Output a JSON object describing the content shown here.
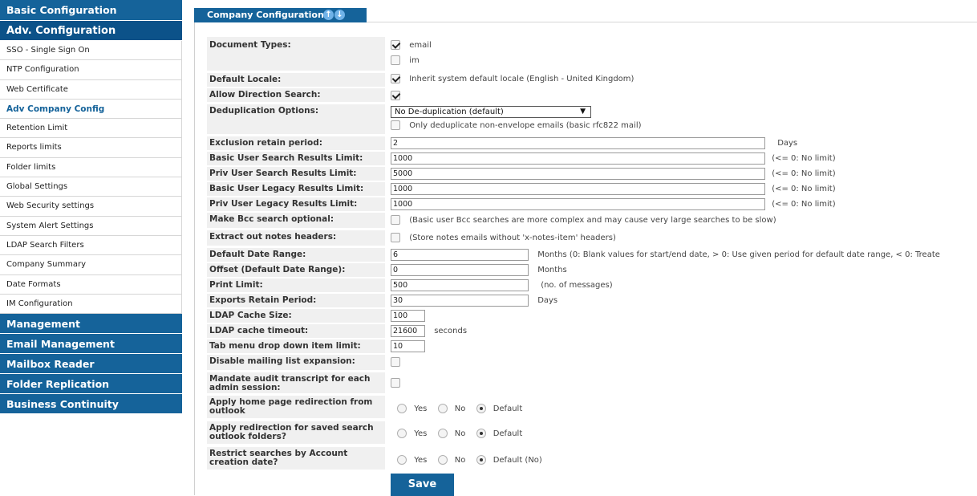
{
  "sidebar": {
    "sections_top": [
      {
        "label": "Basic Configuration"
      },
      {
        "label": "Adv. Configuration"
      }
    ],
    "items": [
      {
        "label": "SSO - Single Sign On"
      },
      {
        "label": "NTP Configuration"
      },
      {
        "label": "Web Certificate"
      },
      {
        "label": "Adv Company Config"
      },
      {
        "label": "Retention Limit"
      },
      {
        "label": "Reports limits"
      },
      {
        "label": "Folder limits"
      },
      {
        "label": "Global Settings"
      },
      {
        "label": "Web Security settings"
      },
      {
        "label": "System Alert Settings"
      },
      {
        "label": "LDAP Search Filters"
      },
      {
        "label": "Company Summary"
      },
      {
        "label": "Date Formats"
      },
      {
        "label": "IM Configuration"
      }
    ],
    "sections_bottom": [
      {
        "label": "Management"
      },
      {
        "label": "Email Management"
      },
      {
        "label": "Mailbox Reader"
      },
      {
        "label": "Folder Replication"
      },
      {
        "label": "Business Continuity"
      }
    ]
  },
  "tab": {
    "label": "Company Configuration"
  },
  "form": {
    "document_types": {
      "label": "Document Types:",
      "email": "email",
      "im": "im"
    },
    "default_locale": {
      "label": "Default Locale:",
      "text": "Inherit system default locale (English - United Kingdom)"
    },
    "allow_direction_search": {
      "label": "Allow Direction Search:"
    },
    "deduplication": {
      "label": "Deduplication Options:",
      "selected": "No De-duplication (default)",
      "only_text": "Only deduplicate non-envelope emails (basic rfc822 mail)"
    },
    "exclusion_retain": {
      "label": "Exclusion retain period:",
      "value": "2",
      "unit": "Days"
    },
    "basic_user_search": {
      "label": "Basic User Search Results Limit:",
      "value": "1000",
      "hint": "(<= 0: No limit)"
    },
    "priv_user_search": {
      "label": "Priv User Search Results Limit:",
      "value": "5000",
      "hint": "(<= 0: No limit)"
    },
    "basic_user_legacy": {
      "label": "Basic User Legacy Results Limit:",
      "value": "1000",
      "hint": "(<= 0: No limit)"
    },
    "priv_user_legacy": {
      "label": "Priv User Legacy Results Limit:",
      "value": "1000",
      "hint": "(<= 0: No limit)"
    },
    "bcc_optional": {
      "label": "Make Bcc search optional:",
      "text": "(Basic user Bcc searches are more complex and may cause very large searches to be slow)"
    },
    "notes_headers": {
      "label": "Extract out notes headers:",
      "text": "(Store notes emails without 'x-notes-item' headers)"
    },
    "default_date_range": {
      "label": "Default Date Range:",
      "value": "6",
      "hint": "Months (0: Blank values for start/end date, > 0: Use given period for default date range, < 0: Treate"
    },
    "offset": {
      "label": "Offset (Default Date Range):",
      "value": "0",
      "hint": "Months"
    },
    "print_limit": {
      "label": "Print Limit:",
      "value": "500",
      "hint": "(no. of messages)"
    },
    "exports_retain": {
      "label": "Exports Retain Period:",
      "value": "30",
      "hint": "Days"
    },
    "ldap_cache_size": {
      "label": "LDAP Cache Size:",
      "value": "100"
    },
    "ldap_cache_timeout": {
      "label": "LDAP cache timeout:",
      "value": "21600",
      "hint": "seconds"
    },
    "tab_menu_limit": {
      "label": "Tab menu drop down item limit:",
      "value": "10"
    },
    "disable_mailing": {
      "label": "Disable mailing list expansion:"
    },
    "mandate_audit": {
      "label": "Mandate audit transcript for each admin session:"
    },
    "home_redirect": {
      "label": "Apply home page redirection from outlook",
      "yes": "Yes",
      "no": "No",
      "default": "Default"
    },
    "saved_search_redirect": {
      "label": "Apply redirection for saved search outlook folders?",
      "yes": "Yes",
      "no": "No",
      "default": "Default"
    },
    "restrict_searches": {
      "label": "Restrict searches by Account creation date?",
      "yes": "Yes",
      "no": "No",
      "default": "Default (No)"
    },
    "save_label": "Save"
  }
}
